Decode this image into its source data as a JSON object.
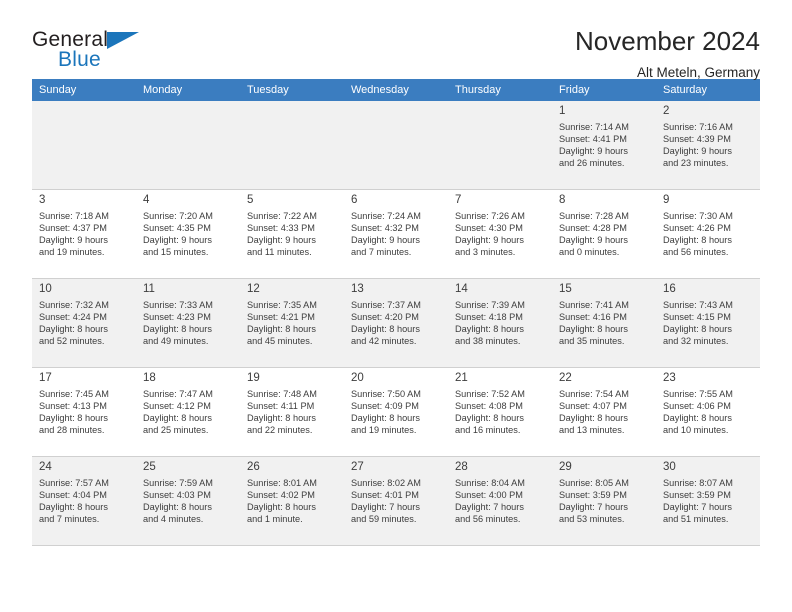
{
  "brand": {
    "name_part1": "General",
    "name_part2": "Blue"
  },
  "header": {
    "title": "November 2024",
    "subtitle": "Alt Meteln, Germany"
  },
  "colors": {
    "header_row": "#3b7dc0",
    "brand_blue": "#1b75bb",
    "shaded_row": "#f1f1f1",
    "text": "#3d3d3d"
  },
  "weekdays": [
    "Sunday",
    "Monday",
    "Tuesday",
    "Wednesday",
    "Thursday",
    "Friday",
    "Saturday"
  ],
  "weeks": [
    [
      {
        "day": "",
        "empty": true
      },
      {
        "day": "",
        "empty": true
      },
      {
        "day": "",
        "empty": true
      },
      {
        "day": "",
        "empty": true
      },
      {
        "day": "",
        "empty": true
      },
      {
        "day": "1",
        "sunrise": "Sunrise: 7:14 AM",
        "sunset": "Sunset: 4:41 PM",
        "daylight1": "Daylight: 9 hours",
        "daylight2": "and 26 minutes."
      },
      {
        "day": "2",
        "sunrise": "Sunrise: 7:16 AM",
        "sunset": "Sunset: 4:39 PM",
        "daylight1": "Daylight: 9 hours",
        "daylight2": "and 23 minutes."
      }
    ],
    [
      {
        "day": "3",
        "sunrise": "Sunrise: 7:18 AM",
        "sunset": "Sunset: 4:37 PM",
        "daylight1": "Daylight: 9 hours",
        "daylight2": "and 19 minutes."
      },
      {
        "day": "4",
        "sunrise": "Sunrise: 7:20 AM",
        "sunset": "Sunset: 4:35 PM",
        "daylight1": "Daylight: 9 hours",
        "daylight2": "and 15 minutes."
      },
      {
        "day": "5",
        "sunrise": "Sunrise: 7:22 AM",
        "sunset": "Sunset: 4:33 PM",
        "daylight1": "Daylight: 9 hours",
        "daylight2": "and 11 minutes."
      },
      {
        "day": "6",
        "sunrise": "Sunrise: 7:24 AM",
        "sunset": "Sunset: 4:32 PM",
        "daylight1": "Daylight: 9 hours",
        "daylight2": "and 7 minutes."
      },
      {
        "day": "7",
        "sunrise": "Sunrise: 7:26 AM",
        "sunset": "Sunset: 4:30 PM",
        "daylight1": "Daylight: 9 hours",
        "daylight2": "and 3 minutes."
      },
      {
        "day": "8",
        "sunrise": "Sunrise: 7:28 AM",
        "sunset": "Sunset: 4:28 PM",
        "daylight1": "Daylight: 9 hours",
        "daylight2": "and 0 minutes."
      },
      {
        "day": "9",
        "sunrise": "Sunrise: 7:30 AM",
        "sunset": "Sunset: 4:26 PM",
        "daylight1": "Daylight: 8 hours",
        "daylight2": "and 56 minutes."
      }
    ],
    [
      {
        "day": "10",
        "sunrise": "Sunrise: 7:32 AM",
        "sunset": "Sunset: 4:24 PM",
        "daylight1": "Daylight: 8 hours",
        "daylight2": "and 52 minutes."
      },
      {
        "day": "11",
        "sunrise": "Sunrise: 7:33 AM",
        "sunset": "Sunset: 4:23 PM",
        "daylight1": "Daylight: 8 hours",
        "daylight2": "and 49 minutes."
      },
      {
        "day": "12",
        "sunrise": "Sunrise: 7:35 AM",
        "sunset": "Sunset: 4:21 PM",
        "daylight1": "Daylight: 8 hours",
        "daylight2": "and 45 minutes."
      },
      {
        "day": "13",
        "sunrise": "Sunrise: 7:37 AM",
        "sunset": "Sunset: 4:20 PM",
        "daylight1": "Daylight: 8 hours",
        "daylight2": "and 42 minutes."
      },
      {
        "day": "14",
        "sunrise": "Sunrise: 7:39 AM",
        "sunset": "Sunset: 4:18 PM",
        "daylight1": "Daylight: 8 hours",
        "daylight2": "and 38 minutes."
      },
      {
        "day": "15",
        "sunrise": "Sunrise: 7:41 AM",
        "sunset": "Sunset: 4:16 PM",
        "daylight1": "Daylight: 8 hours",
        "daylight2": "and 35 minutes."
      },
      {
        "day": "16",
        "sunrise": "Sunrise: 7:43 AM",
        "sunset": "Sunset: 4:15 PM",
        "daylight1": "Daylight: 8 hours",
        "daylight2": "and 32 minutes."
      }
    ],
    [
      {
        "day": "17",
        "sunrise": "Sunrise: 7:45 AM",
        "sunset": "Sunset: 4:13 PM",
        "daylight1": "Daylight: 8 hours",
        "daylight2": "and 28 minutes."
      },
      {
        "day": "18",
        "sunrise": "Sunrise: 7:47 AM",
        "sunset": "Sunset: 4:12 PM",
        "daylight1": "Daylight: 8 hours",
        "daylight2": "and 25 minutes."
      },
      {
        "day": "19",
        "sunrise": "Sunrise: 7:48 AM",
        "sunset": "Sunset: 4:11 PM",
        "daylight1": "Daylight: 8 hours",
        "daylight2": "and 22 minutes."
      },
      {
        "day": "20",
        "sunrise": "Sunrise: 7:50 AM",
        "sunset": "Sunset: 4:09 PM",
        "daylight1": "Daylight: 8 hours",
        "daylight2": "and 19 minutes."
      },
      {
        "day": "21",
        "sunrise": "Sunrise: 7:52 AM",
        "sunset": "Sunset: 4:08 PM",
        "daylight1": "Daylight: 8 hours",
        "daylight2": "and 16 minutes."
      },
      {
        "day": "22",
        "sunrise": "Sunrise: 7:54 AM",
        "sunset": "Sunset: 4:07 PM",
        "daylight1": "Daylight: 8 hours",
        "daylight2": "and 13 minutes."
      },
      {
        "day": "23",
        "sunrise": "Sunrise: 7:55 AM",
        "sunset": "Sunset: 4:06 PM",
        "daylight1": "Daylight: 8 hours",
        "daylight2": "and 10 minutes."
      }
    ],
    [
      {
        "day": "24",
        "sunrise": "Sunrise: 7:57 AM",
        "sunset": "Sunset: 4:04 PM",
        "daylight1": "Daylight: 8 hours",
        "daylight2": "and 7 minutes."
      },
      {
        "day": "25",
        "sunrise": "Sunrise: 7:59 AM",
        "sunset": "Sunset: 4:03 PM",
        "daylight1": "Daylight: 8 hours",
        "daylight2": "and 4 minutes."
      },
      {
        "day": "26",
        "sunrise": "Sunrise: 8:01 AM",
        "sunset": "Sunset: 4:02 PM",
        "daylight1": "Daylight: 8 hours",
        "daylight2": "and 1 minute."
      },
      {
        "day": "27",
        "sunrise": "Sunrise: 8:02 AM",
        "sunset": "Sunset: 4:01 PM",
        "daylight1": "Daylight: 7 hours",
        "daylight2": "and 59 minutes."
      },
      {
        "day": "28",
        "sunrise": "Sunrise: 8:04 AM",
        "sunset": "Sunset: 4:00 PM",
        "daylight1": "Daylight: 7 hours",
        "daylight2": "and 56 minutes."
      },
      {
        "day": "29",
        "sunrise": "Sunrise: 8:05 AM",
        "sunset": "Sunset: 3:59 PM",
        "daylight1": "Daylight: 7 hours",
        "daylight2": "and 53 minutes."
      },
      {
        "day": "30",
        "sunrise": "Sunrise: 8:07 AM",
        "sunset": "Sunset: 3:59 PM",
        "daylight1": "Daylight: 7 hours",
        "daylight2": "and 51 minutes."
      }
    ]
  ]
}
